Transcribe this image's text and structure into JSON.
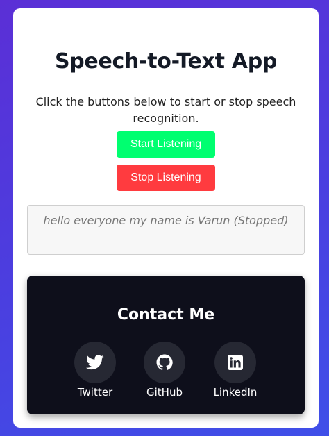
{
  "app": {
    "title": "Speech-to-Text App",
    "subtitle": "Click the buttons below to start or stop speech recognition."
  },
  "controls": {
    "start_label": "Start Listening",
    "stop_label": "Stop Listening"
  },
  "transcript": {
    "text": "hello everyone my name is Varun (Stopped)"
  },
  "contact": {
    "title": "Contact Me",
    "links": [
      {
        "label": "Twitter",
        "icon": "twitter-icon"
      },
      {
        "label": "GitHub",
        "icon": "github-icon"
      },
      {
        "label": "LinkedIn",
        "icon": "linkedin-icon"
      }
    ]
  },
  "colors": {
    "start": "#00ff70",
    "stop": "#ff3b3f",
    "contact_bg": "#0e0f1b",
    "icon_bg": "#262833"
  }
}
